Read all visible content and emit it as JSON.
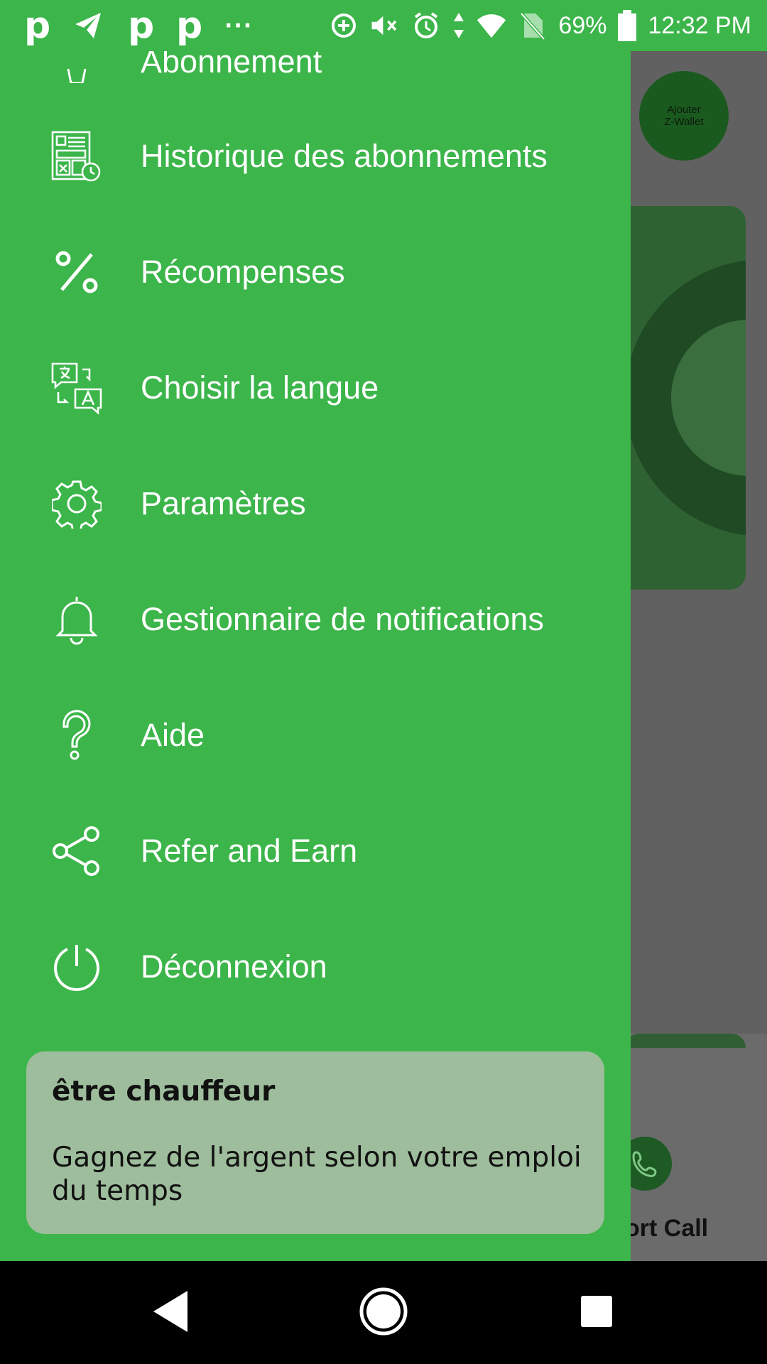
{
  "status_bar": {
    "left_icons": [
      "p-app-icon",
      "telegram-icon",
      "p-app-icon",
      "p-app-icon",
      "more-dots-icon"
    ],
    "p_glyph": "p",
    "dots": "···",
    "right_icons": [
      "data-saver-icon",
      "mute-icon",
      "alarm-icon",
      "data-arrows-icon",
      "wifi-icon",
      "no-sim-icon",
      "battery-icon"
    ],
    "battery": "69%",
    "time": "12:32 PM"
  },
  "background_app": {
    "wallet_button": [
      "Ajouter",
      "Z-Wallet"
    ],
    "support_call_label": "ort Call"
  },
  "drawer": {
    "partial_item": "Abonnement",
    "items": [
      {
        "label": "Historique des abonnements",
        "icon": "subscription-history-icon"
      },
      {
        "label": "Récompenses",
        "icon": "percent-icon"
      },
      {
        "label": "Choisir la langue",
        "icon": "language-icon"
      },
      {
        "label": "Paramètres",
        "icon": "gear-icon"
      },
      {
        "label": "Gestionnaire de notifications",
        "icon": "bell-icon"
      },
      {
        "label": "Aide",
        "icon": "question-icon"
      },
      {
        "label": "Refer and Earn",
        "icon": "share-icon"
      },
      {
        "label": "Déconnexion",
        "icon": "power-icon"
      }
    ],
    "driver_card": {
      "title": "être chauffeur",
      "description": "Gagnez de l'argent selon votre emploi du temps"
    }
  },
  "colors": {
    "drawer_green": "#3cb54a",
    "card_green": "#9ebd9c",
    "scrim": "#616161"
  },
  "nav_bar": {
    "buttons": [
      "back-icon",
      "home-icon",
      "recents-icon"
    ]
  }
}
